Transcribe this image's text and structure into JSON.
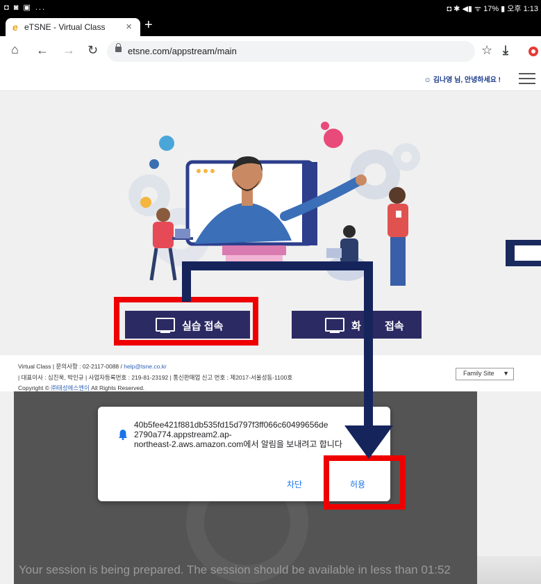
{
  "status_bar": {
    "left_icons": "◘ ◙ ▣ ...",
    "right_text": "◘ ✱ ◀▮ ᯤ 17% ▮ 오후 1:13"
  },
  "browser": {
    "tab_title": "eTSNE - Virtual Class",
    "favicon": "e",
    "url": "etsne.com/appstream/main"
  },
  "site": {
    "greeting": "김나영 님, 안녕하세요 !",
    "buttons": {
      "practice": "실습 접속",
      "screen_prefix": "화",
      "screen_suffix": "접속"
    }
  },
  "footer": {
    "line1_prefix": "Virtual Class  |  문의사항 : 02-2117-0088 / ",
    "email": "help@tsne.co.kr",
    "line2": "|  대표이사 : 심진욱, 박인규  |  사업자등록번호 : 219-81-23192  |  통신판매업 신고 번호 : 제2017-서울성동-1100호",
    "line3_prefix": "Copyright © ",
    "company": "㈜태성에스엔이",
    "line3_suffix": " All Rights Reserved.",
    "family_site": "Family Site"
  },
  "dialog": {
    "message_line1": "40b5fee421f881db535fd15d797f3ff066c60499656de",
    "message_line2": "2790a774.appstream2.ap-",
    "message_line3": "northeast-2.aws.amazon.com에서 알림을 보내려고 합니다",
    "deny": "차단",
    "allow": "허용"
  },
  "session_message": "Your session is being prepared. The session should be available in less than 01:52",
  "colors": {
    "navy": "#2b2a63",
    "highlight": "#ee0000",
    "arrow": "#16245c",
    "link": "#1a73e8"
  }
}
